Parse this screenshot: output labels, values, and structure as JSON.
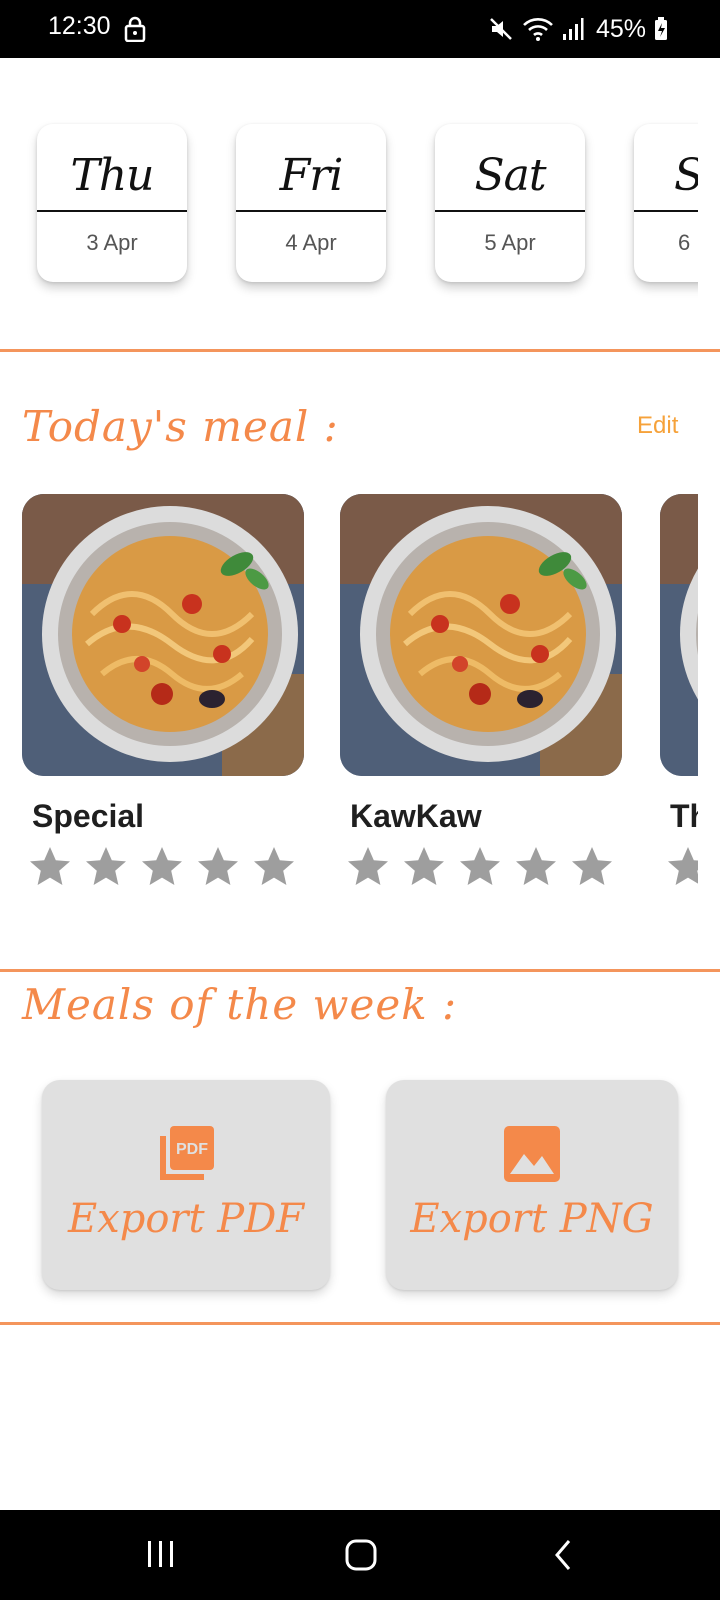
{
  "status_bar": {
    "time": "12:30",
    "battery": "45%",
    "icons": [
      "lock-icon",
      "mute-icon",
      "wifi-icon",
      "signal-icon",
      "battery-icon"
    ]
  },
  "days": [
    {
      "day": "Thu",
      "date": "3 Apr"
    },
    {
      "day": "Fri",
      "date": "4 Apr"
    },
    {
      "day": "Sat",
      "date": "5 Apr"
    },
    {
      "day": "S",
      "date": "6"
    }
  ],
  "todays_meal": {
    "title": "Today's meal :",
    "edit_label": "Edit",
    "meals": [
      {
        "name": "Special",
        "rating": 0,
        "max_rating": 5
      },
      {
        "name": "KawKaw",
        "rating": 0,
        "max_rating": 5
      },
      {
        "name": "Th",
        "rating": 0,
        "max_rating": 5
      }
    ]
  },
  "week": {
    "title": "Meals of the week :",
    "export_pdf_label": "Export PDF",
    "export_png_label": "Export PNG"
  },
  "colors": {
    "accent": "#f4894a",
    "edit": "#f6a23a",
    "divider": "#f4955c",
    "button_bg": "#e0e0e0",
    "star": "#9e9e9e"
  }
}
